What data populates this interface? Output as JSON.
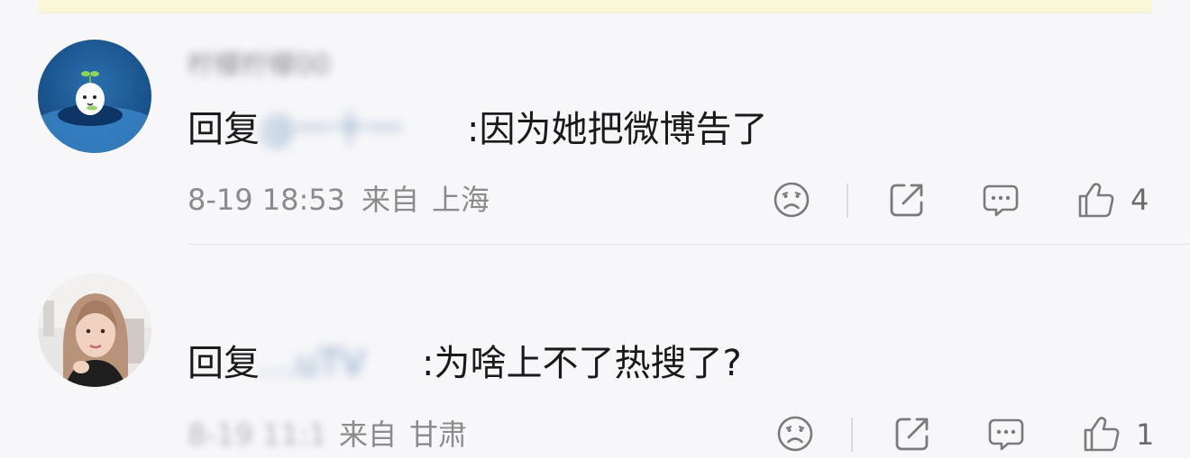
{
  "comments": [
    {
      "username": "柠檬柠檬00",
      "reply_prefix": "回复",
      "reply_target": "@一十一",
      "reply_body": ":因为她把微博告了",
      "time": "8-19 18:53",
      "from_label": "来自",
      "location": "上海",
      "like_count": "4",
      "avatar": "cartoon-sprout-avatar"
    },
    {
      "username": "",
      "reply_prefix": "回复",
      "reply_target": "…uTV",
      "reply_body": ":为啥上不了热搜了?",
      "time": "8-19 11:12",
      "from_label": "来自",
      "location": "甘肃",
      "like_count": "1",
      "avatar": "photo-woman-avatar"
    }
  ],
  "icons": {
    "dislike": "frown-face-icon",
    "share": "share-arrow-icon",
    "comment": "comment-bubble-icon",
    "like": "thumbs-up-icon"
  },
  "colors": {
    "background": "#f7f7f9",
    "text": "#1a1a1a",
    "meta": "#8b8b8b",
    "link": "#507daf",
    "banner": "#faf7d9"
  }
}
